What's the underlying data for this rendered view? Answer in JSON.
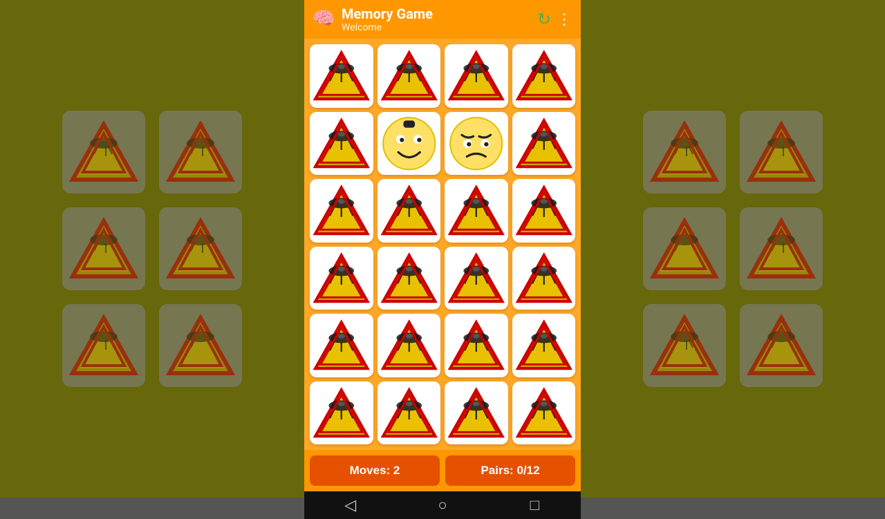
{
  "app": {
    "title": "Memory Game",
    "subtitle": "Welcome",
    "brain_icon": "🧠",
    "refresh_icon": "↻",
    "more_icon": "⋮"
  },
  "grid": {
    "rows": 6,
    "cols": 4,
    "cards": [
      {
        "type": "ufo",
        "id": 0
      },
      {
        "type": "ufo",
        "id": 1
      },
      {
        "type": "ufo",
        "id": 2
      },
      {
        "type": "ufo",
        "id": 3
      },
      {
        "type": "ufo",
        "id": 4
      },
      {
        "type": "happy",
        "id": 5
      },
      {
        "type": "angry",
        "id": 6
      },
      {
        "type": "ufo",
        "id": 7
      },
      {
        "type": "ufo",
        "id": 8
      },
      {
        "type": "ufo",
        "id": 9
      },
      {
        "type": "ufo",
        "id": 10
      },
      {
        "type": "ufo",
        "id": 11
      },
      {
        "type": "ufo",
        "id": 12
      },
      {
        "type": "ufo",
        "id": 13
      },
      {
        "type": "ufo",
        "id": 14
      },
      {
        "type": "ufo",
        "id": 15
      },
      {
        "type": "ufo",
        "id": 16
      },
      {
        "type": "ufo",
        "id": 17
      },
      {
        "type": "ufo",
        "id": 18
      },
      {
        "type": "ufo",
        "id": 19
      },
      {
        "type": "ufo",
        "id": 20
      },
      {
        "type": "ufo",
        "id": 21
      },
      {
        "type": "ufo",
        "id": 22
      },
      {
        "type": "ufo",
        "id": 23
      }
    ]
  },
  "scores": {
    "moves_label": "Moves: 2",
    "pairs_label": "Pairs: 0/12"
  },
  "nav": {
    "back_icon": "◁",
    "home_icon": "○",
    "square_icon": "□"
  },
  "colors": {
    "orange_primary": "#ff9800",
    "orange_dark": "#e65100",
    "app_bar": "#ff9800"
  }
}
